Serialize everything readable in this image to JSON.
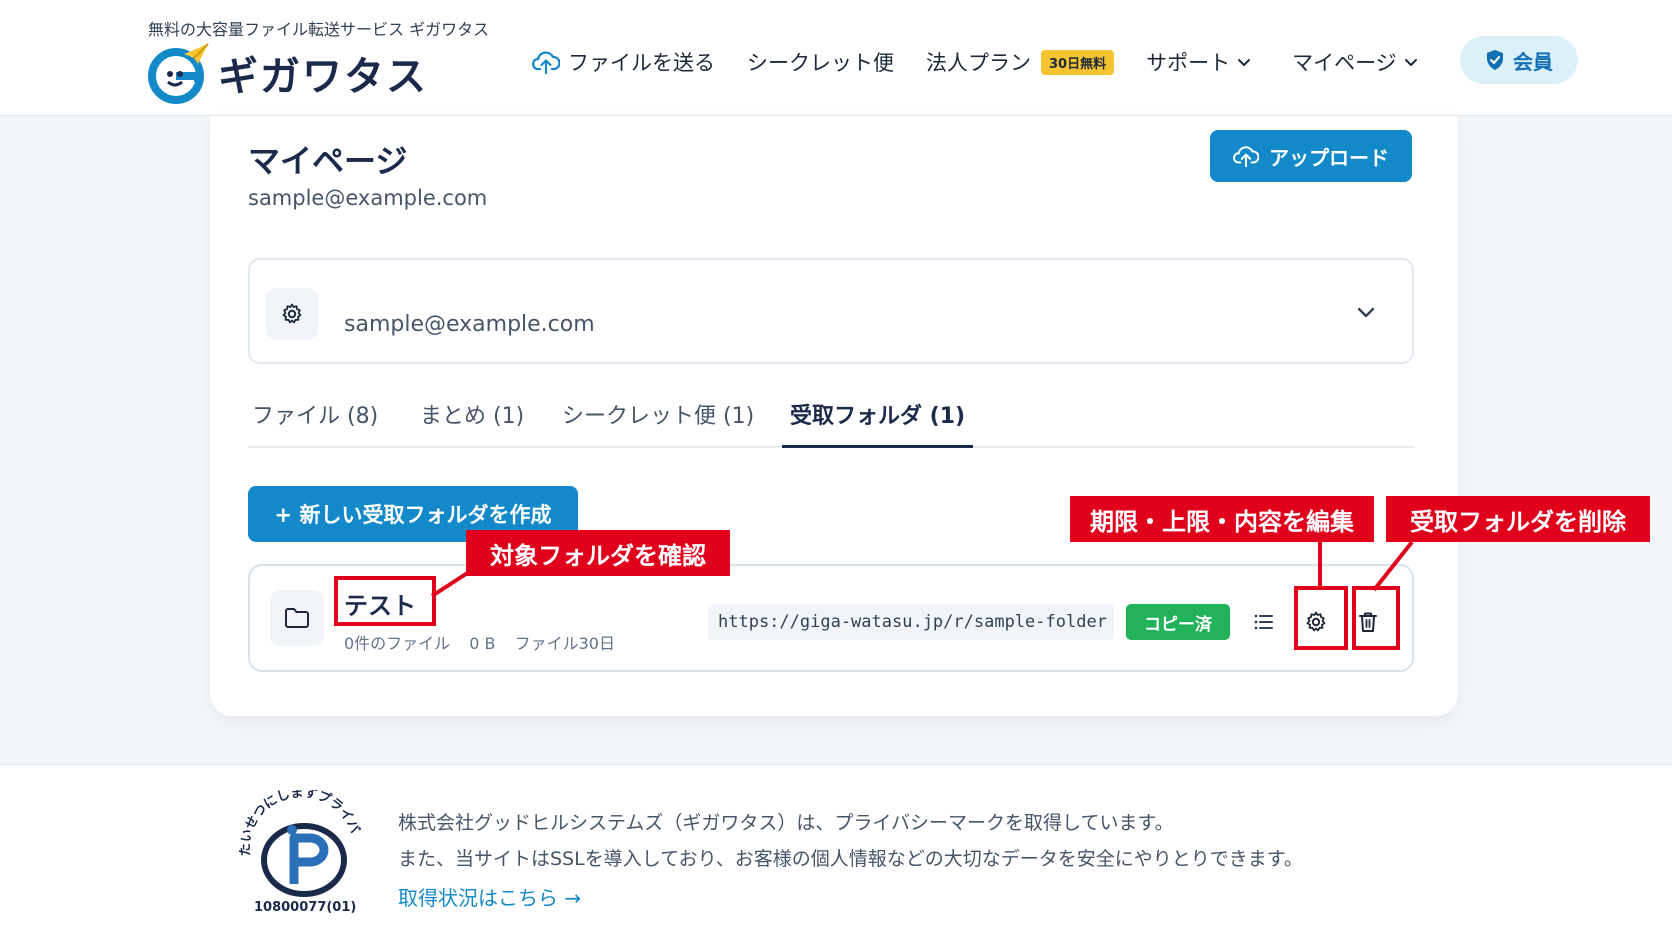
{
  "header": {
    "tagline": "無料の大容量ファイル転送サービス ギガワタス",
    "logo_text": "ギガワタス",
    "nav": {
      "send": "ファイルを送る",
      "secret": "シークレット便",
      "corporate": "法人プラン",
      "corporate_badge": "30日無料",
      "support": "サポート",
      "mypage": "マイページ"
    },
    "member_label": "会員"
  },
  "main": {
    "title": "マイページ",
    "email": "sample@example.com",
    "upload_label": "アップロード",
    "account_select": {
      "value": "sample@example.com"
    },
    "tabs": [
      {
        "label": "ファイル (8)",
        "active": false
      },
      {
        "label": "まとめ (1)",
        "active": false
      },
      {
        "label": "シークレット便 (1)",
        "active": false
      },
      {
        "label": "受取フォルダ (1)",
        "active": true
      }
    ],
    "new_folder_label": "+ 新しい受取フォルダを作成",
    "folder": {
      "name": "テスト",
      "file_count": "0件のファイル",
      "size": "0 B",
      "retention": "ファイル30日",
      "url": "https://giga-watasu.jp/r/sample-folder",
      "copied_label": "コピー済"
    }
  },
  "annotations": {
    "confirm_folder": "対象フォルダを確認",
    "edit_settings": "期限・上限・内容を編集",
    "delete_folder": "受取フォルダを削除"
  },
  "footer": {
    "privacy_mark_text": "たいせつにしますプライバシー",
    "privacy_mark_number": "10800077(01)",
    "line1": "株式会社グッドヒルシステムズ（ギガワタス）は、プライバシーマークを取得しています。",
    "line2": "また、当サイトはSSLを導入しており、お客様の個人情報などの大切なデータを安全にやりとりできます。",
    "link": "取得状況はこちら →"
  },
  "colors": {
    "primary": "#1389c9",
    "navy": "#1b2a4a",
    "annotation_red": "#e0001b",
    "copied_green": "#22b35a",
    "badge_yellow": "#f5c431",
    "background": "#f3f6f9"
  },
  "icons": {
    "send": "cloud-upload-icon",
    "chevron": "chevron-down-icon",
    "member": "shield-check-icon",
    "account": "gear-icon",
    "folder": "folder-icon",
    "list": "list-icon",
    "settings": "gear-icon",
    "delete": "trash-icon"
  }
}
